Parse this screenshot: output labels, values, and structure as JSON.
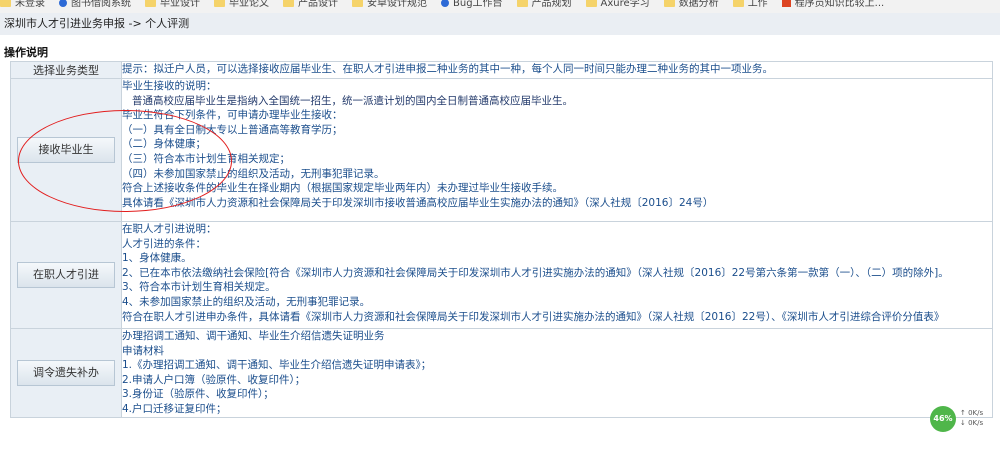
{
  "bookmarks": [
    {
      "label": "未登录",
      "icon": "folder"
    },
    {
      "label": "图书借阅系统",
      "icon": "globe"
    },
    {
      "label": "毕业设计",
      "icon": "folder"
    },
    {
      "label": "毕业论文",
      "icon": "folder"
    },
    {
      "label": "产品设计",
      "icon": "folder"
    },
    {
      "label": "安卓设计规范",
      "icon": "folder"
    },
    {
      "label": "Bug工作台",
      "icon": "globe"
    },
    {
      "label": "产品规划",
      "icon": "folder"
    },
    {
      "label": "Axure学习",
      "icon": "folder"
    },
    {
      "label": "数据分析",
      "icon": "folder"
    },
    {
      "label": "工作",
      "icon": "folder"
    },
    {
      "label": "程序员知识比较上...",
      "icon": "red"
    }
  ],
  "breadcrumb": "深圳市人才引进业务申报 -> 个人评测",
  "section_title": "操作说明",
  "rows": [
    {
      "label": "选择业务类型",
      "is_button": false,
      "lines": [
        "提示：拟迁户人员，可以选择接收应届毕业生、在职人才引进申报二种业务的其中一种，每个人同一时间只能办理二种业务的其中一项业务。"
      ]
    },
    {
      "label": "接收毕业生",
      "is_button": true,
      "lines": [
        "毕业生接收的说明：",
        "普通高校应届毕业生是指纳入全国统一招生，统一派遣计划的国内全日制普通高校应届毕业生。",
        "毕业生符合下列条件，可申请办理毕业生接收：",
        "（一）具有全日制大专以上普通高等教育学历；",
        "（二）身体健康；",
        "（三）符合本市计划生育相关规定；",
        "（四）未参加国家禁止的组织及活动，无刑事犯罪记录。",
        "符合上述接收条件的毕业生在择业期内（根据国家规定毕业两年内）未办理过毕业生接收手续。",
        "具体请看《深圳市人力资源和社会保障局关于印发深圳市接收普通高校应届毕业生实施办法的通知》（深人社规〔2016〕24号）"
      ]
    },
    {
      "label": "在职人才引进",
      "is_button": true,
      "lines": [
        "在职人才引进说明：",
        "人才引进的条件：",
        "1、身体健康。",
        "2、已在本市依法缴纳社会保险[符合《深圳市人力资源和社会保障局关于印发深圳市人才引进实施办法的通知》（深人社规〔2016〕22号第六条第一款第（一）、（二）项的除外]。",
        "3、符合本市计划生育相关规定。",
        "4、未参加国家禁止的组织及活动，无刑事犯罪记录。",
        "符合在职人才引进申办条件，具体请看《深圳市人力资源和社会保障局关于印发深圳市人才引进实施办法的通知》（深人社规〔2016〕22号）、《深圳市人才引进综合评价分值表》"
      ]
    },
    {
      "label": "调令遗失补办",
      "is_button": true,
      "lines": [
        "办理招调工通知、调干通知、毕业生介绍信遗失证明业务",
        "申请材料",
        "1.《办理招调工通知、调干通知、毕业生介绍信遗失证明申请表》；",
        "2.申请人户口簿（验原件、收复印件）；",
        "3.身份证（验原件、收复印件）；",
        "4.户口迁移证复印件；"
      ]
    }
  ],
  "speed_widget": {
    "percent": "46%",
    "up": "0K/s",
    "down": "0K/s"
  }
}
